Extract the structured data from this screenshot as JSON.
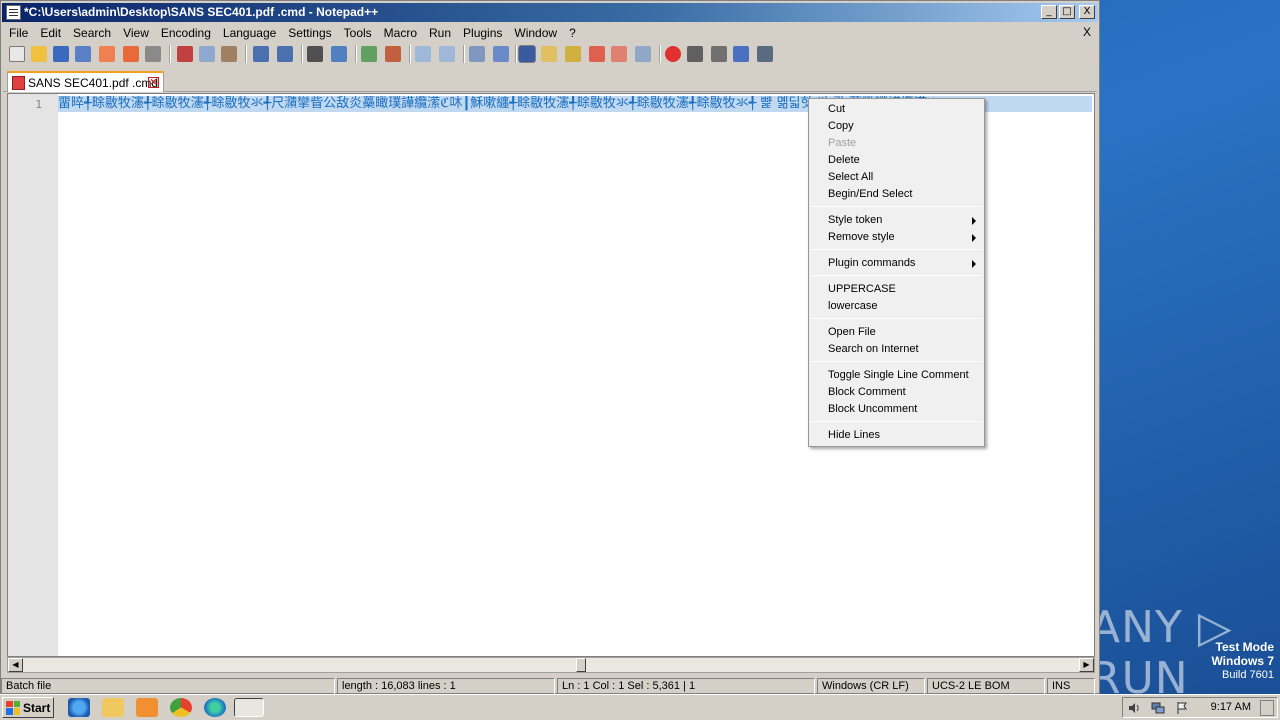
{
  "window": {
    "title": "*C:\\Users\\admin\\Desktop\\SANS SEC401.pdf .cmd - Notepad++",
    "buttons": {
      "minimize": "_",
      "maximize": "□",
      "close": "X"
    }
  },
  "menu": {
    "items": [
      "File",
      "Edit",
      "Search",
      "View",
      "Encoding",
      "Language",
      "Settings",
      "Tools",
      "Macro",
      "Run",
      "Plugins",
      "Window",
      "?"
    ],
    "close_label": "X"
  },
  "toolbar": {
    "icons": [
      "new-file-icon",
      "open-file-icon",
      "save-icon",
      "save-all-icon",
      "close-icon",
      "close-all-icon",
      "print-icon",
      "cut-icon",
      "copy-icon",
      "paste-icon",
      "undo-icon",
      "redo-icon",
      "find-icon",
      "replace-icon",
      "zoom-in-icon",
      "zoom-out-icon",
      "sync-vertical-icon",
      "sync-horizontal-icon",
      "word-wrap-icon",
      "show-all-chars-icon",
      "indent-guide-icon",
      "language-icon",
      "doc-map-icon",
      "function-list-icon",
      "folder-workspace-icon",
      "monitoring-icon",
      "record-macro-icon",
      "stop-macro-icon",
      "play-macro-icon",
      "run-macro-multiple-icon",
      "save-macro-icon"
    ]
  },
  "tab": {
    "label": "SANS SEC401.pdf .cmd",
    "close": "✕"
  },
  "editor": {
    "line_number": "1",
    "line_text": "畱晬╃畭敭牧瀗╃畭敭牧瀗╃畭敭牧氺╃尺濻攣眥公敌炎蘽瞰璞譁纜潆ℭ㕲┃穌嗽纏╃畭敭牧瀗╃畭敭牧氺╃畭敭牧瀗╃畭敭牧氺╃ 뺥 몖딟핫 쏴 뢇 蘽瞰璞譁纜潆ℭ"
  },
  "context_menu": {
    "items": [
      {
        "label": "Cut",
        "disabled": false,
        "submenu": false
      },
      {
        "label": "Copy",
        "disabled": false,
        "submenu": false
      },
      {
        "label": "Paste",
        "disabled": true,
        "submenu": false
      },
      {
        "label": "Delete",
        "disabled": false,
        "submenu": false
      },
      {
        "label": "Select All",
        "disabled": false,
        "submenu": false
      },
      {
        "label": "Begin/End Select",
        "disabled": false,
        "submenu": false
      },
      {
        "label": "Style token",
        "disabled": false,
        "submenu": true
      },
      {
        "label": "Remove style",
        "disabled": false,
        "submenu": true
      },
      {
        "label": "Plugin commands",
        "disabled": false,
        "submenu": true
      },
      {
        "label": "UPPERCASE",
        "disabled": false,
        "submenu": false
      },
      {
        "label": "lowercase",
        "disabled": false,
        "submenu": false
      },
      {
        "label": "Open File",
        "disabled": false,
        "submenu": false
      },
      {
        "label": "Search on Internet",
        "disabled": false,
        "submenu": false
      },
      {
        "label": "Toggle Single Line Comment",
        "disabled": false,
        "submenu": false
      },
      {
        "label": "Block Comment",
        "disabled": false,
        "submenu": false
      },
      {
        "label": "Block Uncomment",
        "disabled": false,
        "submenu": false
      },
      {
        "label": "Hide Lines",
        "disabled": false,
        "submenu": false
      }
    ]
  },
  "status": {
    "filetype": "Batch file",
    "length_lines": "length : 16,083    lines : 1",
    "position": "Ln : 1    Col : 1    Sel : 5,361 | 1",
    "eol": "Windows (CR LF)",
    "encoding": "UCS-2 LE BOM",
    "mode": "INS"
  },
  "taskbar": {
    "start_label": "Start",
    "apps": [
      "internet-explorer-icon",
      "file-explorer-icon",
      "media-player-icon",
      "chrome-icon",
      "edge-icon",
      "notepad-plus-plus-icon"
    ],
    "clock": "9:17 AM"
  },
  "desktop": {
    "watermark": "ANY ▷ RUN",
    "test_mode": "Test Mode",
    "os_name": "Windows 7",
    "build": "Build 7601"
  },
  "colors": {
    "selection": "#c0d8f0",
    "code_text": "#1a6fc0",
    "titlebar_start": "#0a246a",
    "desktop_blue": "#2a73c4"
  }
}
